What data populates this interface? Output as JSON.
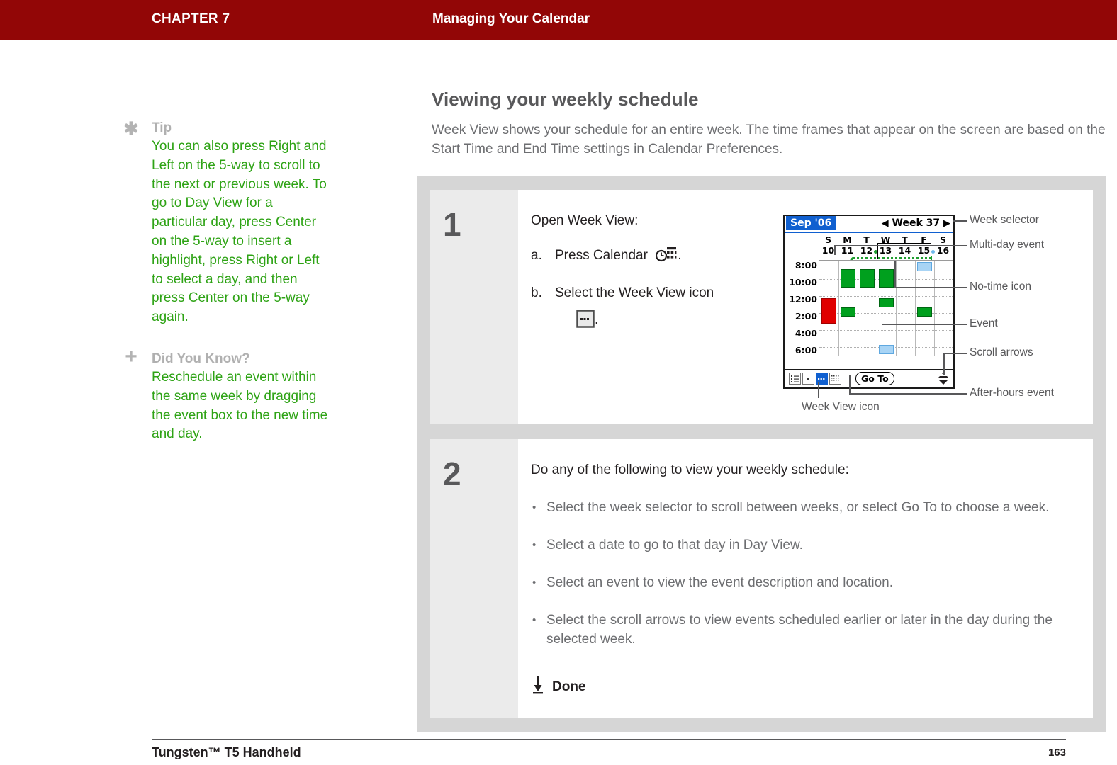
{
  "header": {
    "chapter": "CHAPTER 7",
    "doc_title": "Managing Your Calendar",
    "bg_color": "#920606"
  },
  "sidebar": {
    "notes": [
      {
        "icon": "asterisk-icon",
        "title": "Tip",
        "body": "You can also press Right and Left on the 5-way to scroll to the next or previous week. To go to Day View for a particular day, press Center on the 5-way to insert a highlight, press Right or Left to select a day, and then press Center on the 5-way again."
      },
      {
        "icon": "plus-icon",
        "title": "Did You Know?",
        "body": "Reschedule an event within the same week by dragging the event box to the new time and day."
      }
    ],
    "text_color": "#2ea315",
    "title_color": "#b0b0b0"
  },
  "main": {
    "heading": "Viewing your weekly schedule",
    "intro": "Week View shows your schedule for an entire week. The time frames that appear on the screen are based on the Start Time and End Time settings in Calendar Preferences."
  },
  "steps": [
    {
      "number": "1",
      "intro": "Open Week View:",
      "substeps": [
        {
          "label": "a.",
          "text": "Press Calendar",
          "icon": "calendar-hardware-button-icon",
          "suffix": "."
        },
        {
          "label": "b.",
          "text": "Select the Week View icon",
          "icon": "week-view-icon",
          "suffix": "."
        }
      ]
    },
    {
      "number": "2",
      "intro": "Do any of the following to view your weekly schedule:",
      "bullets": [
        "Select the week selector to scroll between weeks, or select Go To to choose a week.",
        "Select a date to go to that day in Day View.",
        "Select an event to view the event description and location.",
        "Select the scroll arrows to view events scheduled earlier or later in the day during the selected week."
      ],
      "done_label": "Done"
    }
  ],
  "device": {
    "title_bar": {
      "month": "Sep '06",
      "prev_arrow": "◀",
      "week_label": "Week 37",
      "next_arrow": "▶",
      "accent_color": "#1060d0"
    },
    "day_headers": [
      {
        "dow": "S",
        "date": "10"
      },
      {
        "dow": "M",
        "date": "11"
      },
      {
        "dow": "T",
        "date": "12"
      },
      {
        "dow": "W",
        "date": "13"
      },
      {
        "dow": "T",
        "date": "14"
      },
      {
        "dow": "F",
        "date": "15"
      },
      {
        "dow": "S",
        "date": "16"
      }
    ],
    "time_labels": [
      "8:00",
      "10:00",
      "12:00",
      "2:00",
      "4:00",
      "6:00"
    ],
    "event_colors": {
      "green": "#00a01e",
      "green_border": "#006612",
      "red": "#e00000",
      "red_border": "#a00000",
      "blue": "#a8d4f5",
      "blue_border": "#5fa8e0"
    },
    "events": [
      {
        "day": 0,
        "color": "red",
        "start": "1:00",
        "note": "after-noon event Sunday"
      },
      {
        "day": 1,
        "color": "green",
        "start": "9:00",
        "note": "morning event Monday"
      },
      {
        "day": 2,
        "color": "green",
        "start": "9:00",
        "note": "morning event Tuesday"
      },
      {
        "day": 3,
        "color": "green",
        "start": "9:00",
        "note": "morning event Wednesday"
      },
      {
        "day": 1,
        "color": "green",
        "start": "2:00",
        "note": "afternoon event Monday"
      },
      {
        "day": 3,
        "color": "green",
        "start": "1:00",
        "note": "afternoon event Wednesday"
      },
      {
        "day": 5,
        "color": "green",
        "start": "2:00",
        "note": "afternoon event Friday"
      },
      {
        "day": 5,
        "color": "blue",
        "start": "8:00",
        "note": "no-time icon Friday"
      },
      {
        "day": 3,
        "color": "blue",
        "start": "7:00",
        "note": "after-hours event Wednesday"
      }
    ],
    "multi_day_event": {
      "from_day": 2,
      "to_day": 3,
      "color": "#1e9e2e"
    },
    "no_time_dots": [
      {
        "day": 3,
        "color": "#1e9e2e"
      },
      {
        "day": 6,
        "color": "#6fb8ec"
      }
    ],
    "toolbar": {
      "view_buttons": [
        "agenda-view-icon",
        "day-view-icon",
        "week-view-icon",
        "month-view-icon"
      ],
      "selected_index": 2,
      "goto_label": "Go To",
      "scroll_arrows": "scroll-arrows-icon"
    }
  },
  "callouts": [
    {
      "label": "Week selector"
    },
    {
      "label": "Multi-day event"
    },
    {
      "label": "No-time icon"
    },
    {
      "label": "Event"
    },
    {
      "label": "Scroll arrows"
    },
    {
      "label": "After-hours event"
    },
    {
      "label": "Week View icon"
    }
  ],
  "footer": {
    "brand_bold": "Tungsten™ T5",
    "brand_rest": " Handheld",
    "page": "163"
  }
}
